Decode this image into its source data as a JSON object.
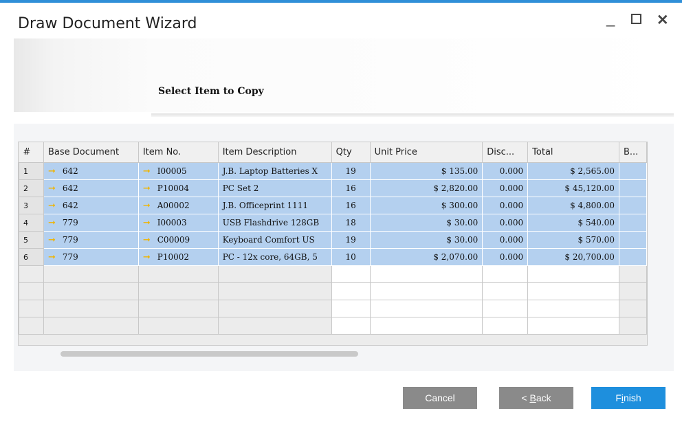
{
  "window": {
    "title": "Draw Document Wizard",
    "controls": [
      "minimize-icon",
      "maximize-icon",
      "close-icon"
    ]
  },
  "step": {
    "heading": "Select Item to Copy"
  },
  "grid": {
    "columns": [
      "#",
      "Base Document",
      "Item No.",
      "Item Description",
      "Qty",
      "Unit Price",
      "Disc...",
      "Total",
      "B..."
    ],
    "rows": [
      [
        "1",
        "642",
        "I00005",
        "J.B. Laptop Batteries X",
        "19",
        "$ 135.00",
        "0.000",
        "$ 2,565.00",
        ""
      ],
      [
        "2",
        "642",
        "P10004",
        "PC Set 2",
        "16",
        "$ 2,820.00",
        "0.000",
        "$ 45,120.00",
        ""
      ],
      [
        "3",
        "642",
        "A00002",
        "J.B. Officeprint 1111",
        "16",
        "$ 300.00",
        "0.000",
        "$ 4,800.00",
        ""
      ],
      [
        "4",
        "779",
        "I00003",
        "USB Flashdrive 128GB",
        "18",
        "$ 30.00",
        "0.000",
        "$ 540.00",
        ""
      ],
      [
        "5",
        "779",
        "C00009",
        "Keyboard Comfort US",
        "19",
        "$ 30.00",
        "0.000",
        "$ 570.00",
        ""
      ],
      [
        "6",
        "779",
        "P10002",
        "PC - 12x core, 64GB, 5",
        "10",
        "$ 2,070.00",
        "0.000",
        "$ 20,700.00",
        ""
      ]
    ]
  },
  "buttons": {
    "cancel": "Cancel",
    "back_prefix": "< ",
    "back_key": "B",
    "back_rest": "ack",
    "finish_pre": "F",
    "finish_key": "i",
    "finish_rest": "nish"
  },
  "colors": {
    "accent": "#1e8fdd",
    "selection": "#b4d0ef",
    "link_arrow": "#f0b400"
  }
}
